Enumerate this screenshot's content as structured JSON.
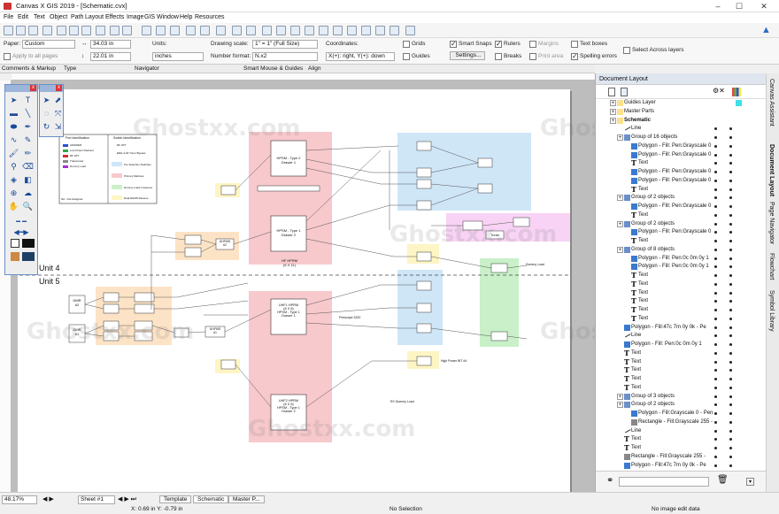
{
  "window": {
    "title": "Canvas X GIS 2019 - [Schematic.cvx]"
  },
  "menu": [
    "File",
    "Edit",
    "Text",
    "Object",
    "Path",
    "Layout",
    "Effects",
    "Image",
    "GIS",
    "Window",
    "Help",
    "Resources"
  ],
  "docsetup": {
    "paper_label": "Paper:",
    "paper_value": "Custom",
    "apply_label": "Apply to all pages",
    "width": "34.03 in",
    "height": "22.01 in",
    "units_label": "Units:",
    "units_value": "inches",
    "scale_label": "Drawing scale:",
    "scale_value": "1\" = 1\"   (Full Size)",
    "format_label": "Number format:",
    "format_value": "N.x2",
    "coords_label": "Coordinates:",
    "coords_value": "X(+): right, Y(+): down",
    "grids": "Grids",
    "guides": "Guides",
    "smart_snaps": "Smart Snaps",
    "settings": "Settings...",
    "rulers": "Rulers",
    "breaks": "Breaks",
    "margins": "Margins",
    "print_area": "Print area",
    "text_boxes": "Text boxes",
    "spelling": "Spelling errors",
    "select_across": "Select Across layers"
  },
  "sections": [
    "Comments & Markup",
    "Type",
    "Navigator",
    "Smart Mouse & Guides",
    "Align"
  ],
  "diagram": {
    "unit4": "Unit 4",
    "unit5": "Unit 5",
    "legend_left": [
      "Port Identification",
      "ANSWER",
      "Low Power Redirect",
      "RF W/T",
      "Transceiver",
      "Dummy Load",
      "NA - Not Assigned"
    ],
    "legend_right": [
      "Switch Identification",
      "RF W/T",
      "ERH-4-02 Tuner Bypass",
      "Pre Selection Switches",
      "Primary Matrixes",
      "Dummy Load Crossover",
      "Dual DHMS Receive"
    ],
    "blocks": {
      "hpsm_drawer1": "HPSM - Type 2\nDrawer 1",
      "hpsm_drawer2": "HPSM - Type 1\nDrawer 2",
      "hf_hprm": "HF HPRM\n(6 X 11)",
      "uhf1": "UHF1 HPRM\n(6 X 6)\nHPSM - Type 1\nDrawer 1",
      "uhf2": "UHF2 HPRM\n(6 X 6)\nHPSM - Type 1\nDrawer 2",
      "tuner": "Tuner",
      "dmr2": "DMR\n#2",
      "dmr1": "DMR\n#1",
      "unhfms": "UHFMS\n#2",
      "unhfm1": "UHFMS\n#1",
      "dummy": "Dummy Load",
      "periscope": "Periscope 3220",
      "highpower": "High Power BIT #4",
      "rx_dummy": "RX Dummy Load"
    },
    "watermark": "Ghostxx.com"
  },
  "document_layout": {
    "header": "Document Layout",
    "rows": [
      {
        "label": "Guides Layer",
        "indent": 0,
        "kind": "layer"
      },
      {
        "label": "Master Parts",
        "indent": 0,
        "kind": "layer"
      },
      {
        "label": "Schematic",
        "indent": 0,
        "kind": "layer-bold"
      },
      {
        "label": "Line",
        "indent": 1,
        "kind": "line"
      },
      {
        "label": "Group of 16 objects",
        "indent": 1,
        "kind": "group"
      },
      {
        "label": "Polygon - Fill: Pen:Grayscale 0",
        "indent": 2,
        "kind": "poly"
      },
      {
        "label": "Polygon - Fill: Pen:Grayscale 0",
        "indent": 2,
        "kind": "poly"
      },
      {
        "label": "Text",
        "indent": 2,
        "kind": "text"
      },
      {
        "label": "Polygon - Fill: Pen:Grayscale 0",
        "indent": 2,
        "kind": "poly"
      },
      {
        "label": "Polygon - Fill: Pen:Grayscale 0",
        "indent": 2,
        "kind": "poly"
      },
      {
        "label": "Text",
        "indent": 2,
        "kind": "text"
      },
      {
        "label": "Group of 2 objects",
        "indent": 1,
        "kind": "group"
      },
      {
        "label": "Polygon - Fill: Pen:Grayscale 0",
        "indent": 2,
        "kind": "poly"
      },
      {
        "label": "Text",
        "indent": 2,
        "kind": "text"
      },
      {
        "label": "Group of 2 objects",
        "indent": 1,
        "kind": "group"
      },
      {
        "label": "Polygon - Fill: Pen:Grayscale 0",
        "indent": 2,
        "kind": "poly"
      },
      {
        "label": "Text",
        "indent": 2,
        "kind": "text"
      },
      {
        "label": "Group of 8 objects",
        "indent": 1,
        "kind": "group"
      },
      {
        "label": "Polygon - Fill: Pen:0c 0m 0y 1",
        "indent": 2,
        "kind": "poly"
      },
      {
        "label": "Polygon - Fill: Pen:0c 0m 0y 1",
        "indent": 2,
        "kind": "poly"
      },
      {
        "label": "Text",
        "indent": 2,
        "kind": "text"
      },
      {
        "label": "Text",
        "indent": 2,
        "kind": "text"
      },
      {
        "label": "Text",
        "indent": 2,
        "kind": "text"
      },
      {
        "label": "Text",
        "indent": 2,
        "kind": "text"
      },
      {
        "label": "Text",
        "indent": 2,
        "kind": "text"
      },
      {
        "label": "Text",
        "indent": 2,
        "kind": "text"
      },
      {
        "label": "Polygon - Fill:47c 7m 0y 0k - Pe",
        "indent": 1,
        "kind": "poly"
      },
      {
        "label": "Line",
        "indent": 1,
        "kind": "line"
      },
      {
        "label": "Polygon - Fill: Pen:0c 0m 0y 1",
        "indent": 1,
        "kind": "poly"
      },
      {
        "label": "Text",
        "indent": 1,
        "kind": "text"
      },
      {
        "label": "Text",
        "indent": 1,
        "kind": "text"
      },
      {
        "label": "Text",
        "indent": 1,
        "kind": "text"
      },
      {
        "label": "Text",
        "indent": 1,
        "kind": "text"
      },
      {
        "label": "Text",
        "indent": 1,
        "kind": "text"
      },
      {
        "label": "Group of 3 objects",
        "indent": 1,
        "kind": "group"
      },
      {
        "label": "Group of 2 objects",
        "indent": 1,
        "kind": "group"
      },
      {
        "label": "Polygon - Fill:Grayscale 0 - Pen",
        "indent": 2,
        "kind": "poly"
      },
      {
        "label": "Rectangle - Fill:Grayscale 255 -",
        "indent": 2,
        "kind": "rect"
      },
      {
        "label": "Line",
        "indent": 1,
        "kind": "line"
      },
      {
        "label": "Text",
        "indent": 1,
        "kind": "text"
      },
      {
        "label": "Text",
        "indent": 1,
        "kind": "text"
      },
      {
        "label": "Rectangle - Fill:Grayscale 255 -",
        "indent": 1,
        "kind": "rect"
      },
      {
        "label": "Polygon - Fill:47c 7m 0y 0k - Pe",
        "indent": 1,
        "kind": "poly"
      }
    ]
  },
  "side_tabs": [
    "Canvas Assistant",
    "Document Layout",
    "Page Navigator",
    "Flowchart",
    "Symbol Library"
  ],
  "status": {
    "zoom": "48.17%",
    "sheet": "Sheet #1",
    "tabs": [
      "Template",
      "Schematic",
      "Master P..."
    ],
    "coords": "X: 0.69 in Y: -0.79 in",
    "selection": "No Selection",
    "image": "No image edit data"
  },
  "colors": {
    "pink": "#f7c9cc",
    "blue": "#cfe6f7",
    "green": "#c9f0c9",
    "orange": "#fde3c6",
    "yellow": "#fdf5c3",
    "magenta": "#f8d3f5",
    "accent": "#2b6cc4"
  }
}
